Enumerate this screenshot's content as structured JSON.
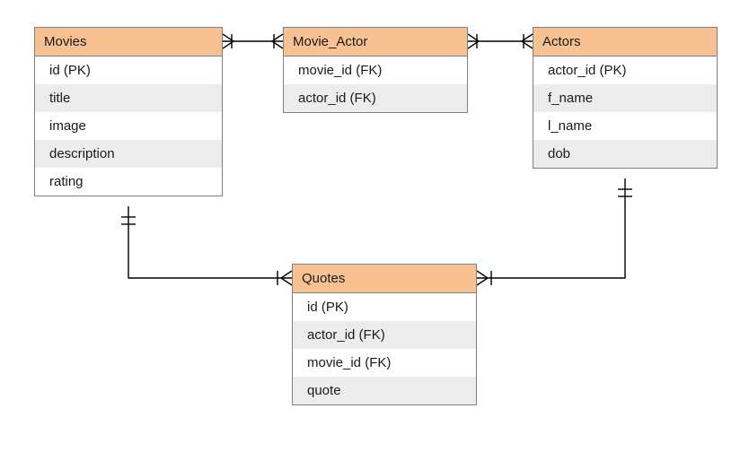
{
  "entities": {
    "movies": {
      "title": "Movies",
      "fields": [
        "id (PK)",
        "title",
        "image",
        "description",
        "rating"
      ]
    },
    "movie_actor": {
      "title": "Movie_Actor",
      "fields": [
        "movie_id (FK)",
        "actor_id (FK)"
      ]
    },
    "actors": {
      "title": "Actors",
      "fields": [
        "actor_id (PK)",
        "f_name",
        "l_name",
        "dob"
      ]
    },
    "quotes": {
      "title": "Quotes",
      "fields": [
        "id (PK)",
        "actor_id (FK)",
        "movie_id (FK)",
        "quote"
      ]
    }
  },
  "chart_data": {
    "type": "er-diagram",
    "tables": [
      {
        "name": "Movies",
        "columns": [
          "id (PK)",
          "title",
          "image",
          "description",
          "rating"
        ]
      },
      {
        "name": "Movie_Actor",
        "columns": [
          "movie_id (FK)",
          "actor_id (FK)"
        ]
      },
      {
        "name": "Actors",
        "columns": [
          "actor_id (PK)",
          "f_name",
          "l_name",
          "dob"
        ]
      },
      {
        "name": "Quotes",
        "columns": [
          "id (PK)",
          "actor_id (FK)",
          "movie_id (FK)",
          "quote"
        ]
      }
    ],
    "relationships": [
      {
        "from": "Movies",
        "to": "Movie_Actor",
        "type": "one-to-many"
      },
      {
        "from": "Actors",
        "to": "Movie_Actor",
        "type": "one-to-many"
      },
      {
        "from": "Movies",
        "to": "Quotes",
        "type": "one-to-many"
      },
      {
        "from": "Actors",
        "to": "Quotes",
        "type": "one-to-many"
      }
    ]
  }
}
